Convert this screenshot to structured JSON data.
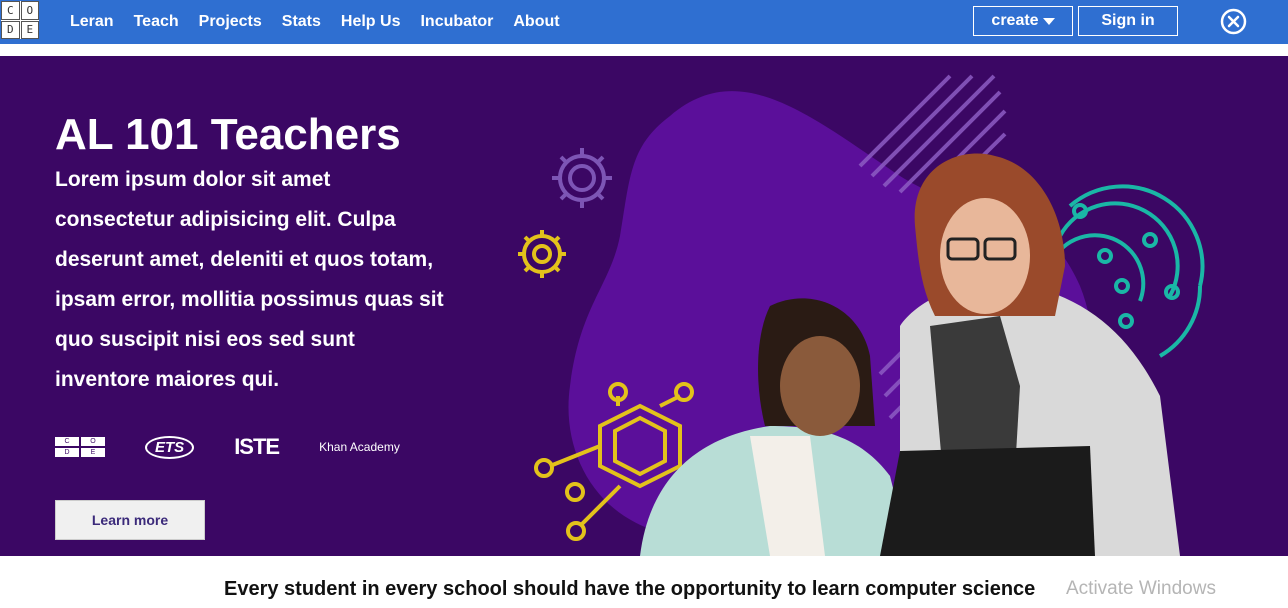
{
  "nav": {
    "logo_letters": [
      "C",
      "O",
      "D",
      "E"
    ],
    "links": [
      "Leran",
      "Teach",
      "Projects",
      "Stats",
      "Help Us",
      "Incubator",
      "About"
    ],
    "create_label": "create",
    "signin_label": "Sign in",
    "close_icon": "close-circle-icon",
    "bar_color": "#2f6fd1"
  },
  "hero": {
    "title": "AL 101 Teachers",
    "body": "Lorem ipsum dolor sit amet consectetur adipisicing elit. Culpa deserunt amet, deleniti et quos totam, ipsam error, mollitia possimus quas sit quo suscipit nisi eos sed sunt inventore maiores qui.",
    "partners": {
      "code_letters": [
        "C",
        "O",
        "D",
        "E"
      ],
      "ets": "ETS",
      "iste": "ISTE",
      "khan": "Khan Academy"
    },
    "learn_more_label": "Learn more",
    "background_color": "#3b0764"
  },
  "tagline": "Every student in every school should have the opportunity to learn computer science",
  "watermark": "Activate Windows"
}
